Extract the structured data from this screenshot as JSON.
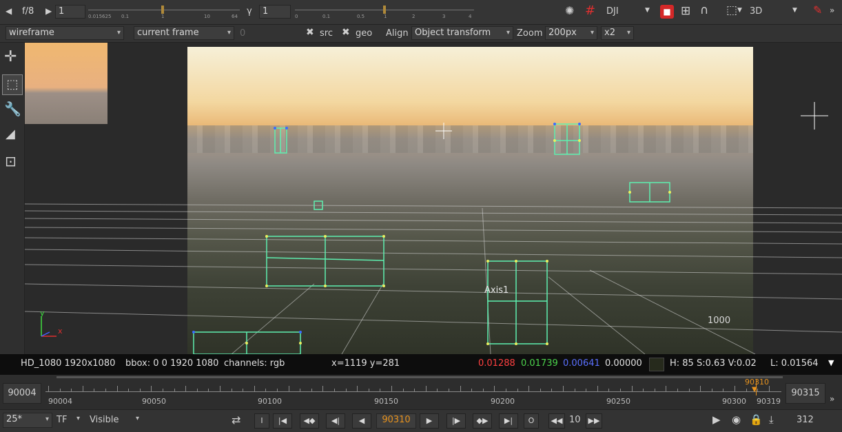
{
  "toolbar": {
    "fstop": "f/8",
    "gain_value": "1",
    "gain_scale": [
      "0.015625",
      "0.1",
      "1",
      "10",
      "64"
    ],
    "gamma_label": "γ",
    "gamma_value": "1",
    "gamma_scale": [
      "0",
      "0.1",
      "0.5",
      "1",
      "2",
      "3",
      "4"
    ],
    "viewer_lut": "DJI",
    "view_mode": "3D"
  },
  "secondary": {
    "display_mode": "wireframe",
    "frame_mode": "current frame",
    "frame_offset": "0",
    "src_label": "src",
    "geo_label": "geo",
    "align_label": "Align",
    "align_value": "Object transform",
    "zoom_label": "Zoom",
    "zoom_value": "200px",
    "zoom_mult": "x2"
  },
  "viewer": {
    "axis_label": "Axis1",
    "grid_label": "1000",
    "axis_x": "x",
    "axis_y": "y"
  },
  "status": {
    "format": "HD_1080 1920x1080",
    "bbox": "bbox: 0 0 1920 1080",
    "channels": "channels: rgb",
    "coords": "x=1119 y=281",
    "r": "0.01288",
    "g": "0.01739",
    "b": "0.00641",
    "a": "0.00000",
    "hsv": "H: 85 S:0.63 V:0.02",
    "lum": "L: 0.01564",
    "colors": {
      "r": "#ff4040",
      "g": "#4cd44c",
      "b": "#5a70ff"
    }
  },
  "timeline": {
    "start": "90004",
    "end": "90315",
    "current": "90310",
    "ticks": [
      "90004",
      "90050",
      "90100",
      "90150",
      "90200",
      "90250",
      "90300",
      "90319"
    ],
    "accent": "#e8931e"
  },
  "transport": {
    "fps": "25*",
    "tf": "TF",
    "visibility": "Visible",
    "current_frame": "90310",
    "step": "10",
    "frame_count": "312",
    "key_i": "I",
    "key_o": "O"
  }
}
